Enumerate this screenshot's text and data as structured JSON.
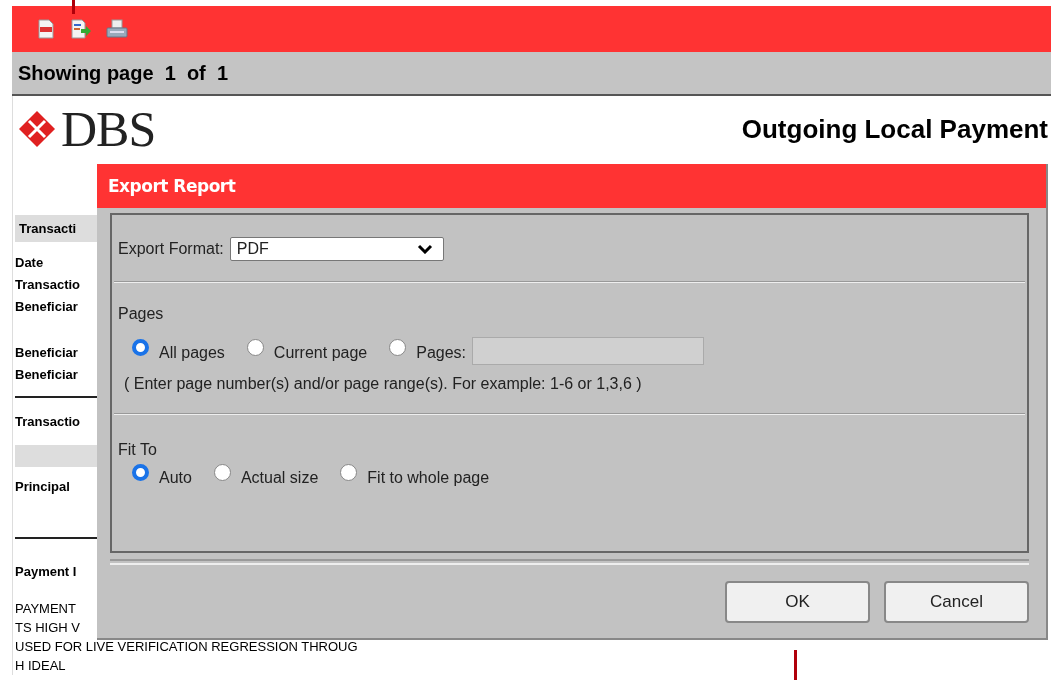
{
  "pager": {
    "text": "Showing page  1  of  1"
  },
  "report": {
    "logo": "DBS",
    "title": "Outgoing Local Payment",
    "section_header": "Transacti",
    "details_a": [
      "Date",
      "Transactio",
      "Beneficiar"
    ],
    "details_b": [
      "Beneficiar",
      "Beneficiar"
    ],
    "transaction_label": "Transactio",
    "principal_label": "Principal",
    "payment_label": "Payment I",
    "payment_lines": [
      "PAYMENT",
      "TS HIGH V",
      "USED FOR LIVE VERIFICATION REGRESSION THROUG",
      "H IDEAL"
    ]
  },
  "dialog": {
    "title": "Export Report",
    "export_format": {
      "label": "Export Format:",
      "value": "PDF"
    },
    "pages": {
      "label": "Pages",
      "options": [
        {
          "label": "All pages",
          "selected": true,
          "kind": "plain"
        },
        {
          "label": "Current page",
          "selected": false,
          "kind": "plain"
        },
        {
          "label": "Pages:",
          "selected": false,
          "kind": "range"
        }
      ],
      "hint": "( Enter page number(s) and/or page range(s). For example: 1-6 or 1,3,6 )"
    },
    "fit_to": {
      "label": "Fit To",
      "options": [
        {
          "label": "Auto",
          "selected": true
        },
        {
          "label": "Actual size",
          "selected": false
        },
        {
          "label": "Fit to whole page",
          "selected": false
        }
      ]
    },
    "buttons": [
      "OK",
      "Cancel"
    ]
  }
}
